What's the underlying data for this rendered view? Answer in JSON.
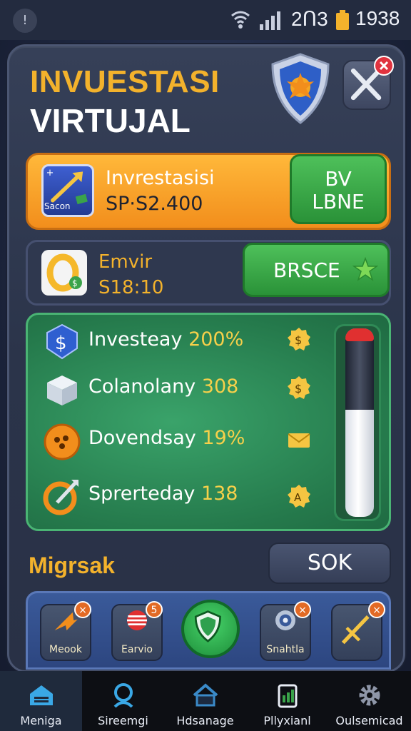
{
  "status_bar": {
    "left_value": "2ᑎ3",
    "right_value": "1938"
  },
  "header": {
    "title_line1": "INVUESTASI",
    "title_line2": "VIRTUJAL"
  },
  "card_primary": {
    "icon_label": "Sacon",
    "title": "Invrestasisi",
    "value": "SP·S2.400",
    "button_label_line1": "BV",
    "button_label_line2": "LBNE"
  },
  "card_secondary": {
    "title": "Emvir",
    "value": "S18:10",
    "button_label": "BRSCE"
  },
  "invest_list": [
    {
      "label": "Investeay",
      "value": "200%",
      "icon": "dollar-shield-icon",
      "coin": "dollar-coin-icon"
    },
    {
      "label": "Colanolany",
      "value": "308",
      "icon": "box-icon",
      "coin": "dollar-coin-icon"
    },
    {
      "label": "Dovendsay",
      "value": "19%",
      "icon": "orange-coin-icon",
      "coin": "envelope-icon"
    },
    {
      "label": "Sprerteday",
      "value": "138",
      "icon": "ring-arrow-icon",
      "coin": "a-coin-icon"
    }
  ],
  "progress_tube": {
    "fill_dark_fraction": 0.43
  },
  "section": {
    "label": "Migrsak",
    "button_label": "SOK"
  },
  "items": [
    {
      "label": "Meook",
      "icon": "arrow-icon",
      "badge": "×"
    },
    {
      "label": "Earvio",
      "icon": "striped-ball-icon",
      "badge": "5"
    },
    {
      "label": "",
      "icon": "shield-icon",
      "badge": ""
    },
    {
      "label": "Snahtla",
      "icon": "target-icon",
      "badge": "×"
    },
    {
      "label": "",
      "icon": "sword-icon",
      "badge": "×"
    }
  ],
  "bottom_nav": [
    {
      "label": "Meniga",
      "icon": "home-icon",
      "active": true
    },
    {
      "label": "Sireemgi",
      "icon": "search-icon",
      "active": false
    },
    {
      "label": "Hdsanage",
      "icon": "house-outline-icon",
      "active": false
    },
    {
      "label": "Pllyxianl",
      "icon": "clipboard-icon",
      "active": false
    },
    {
      "label": "Oulsemicad",
      "icon": "gear-icon",
      "active": false
    }
  ],
  "colors": {
    "accent_orange": "#f3b22c",
    "button_green": "#2a9238",
    "panel_dark": "#2b344a",
    "close_red": "#e0333f"
  }
}
